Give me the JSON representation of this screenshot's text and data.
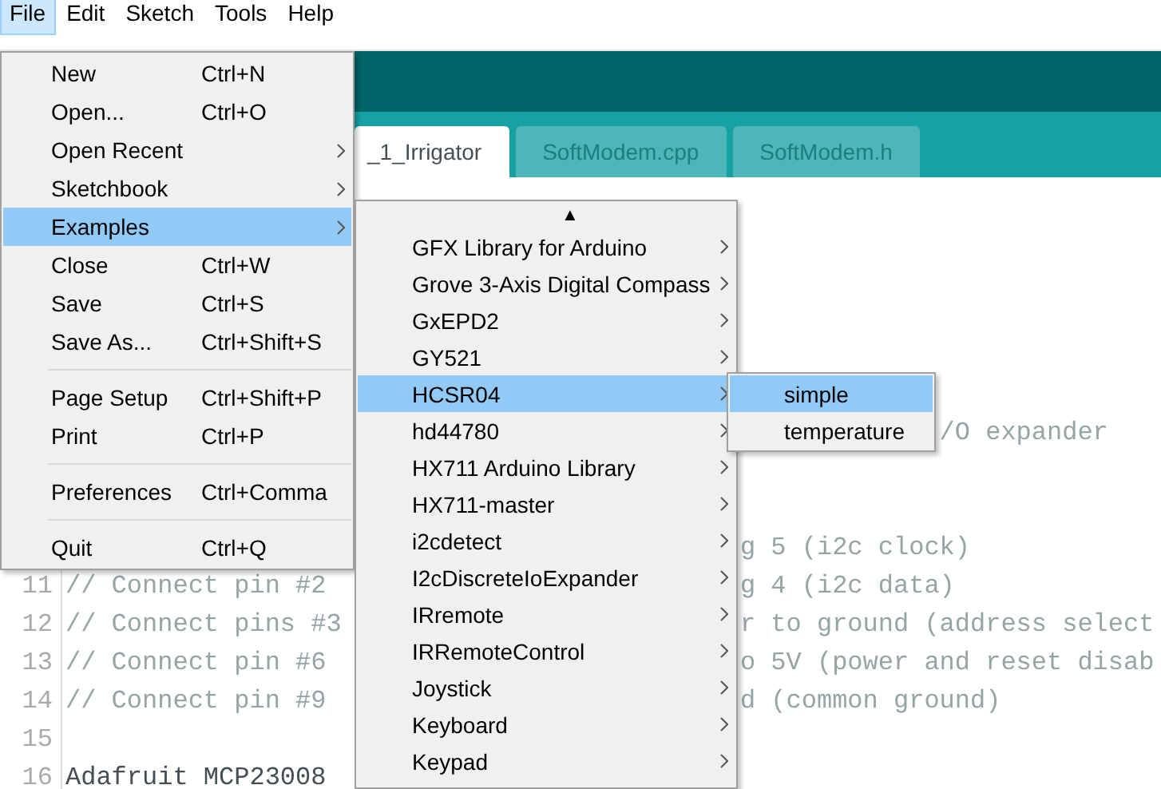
{
  "menubar": [
    {
      "label": "File",
      "selected": true
    },
    {
      "label": "Edit",
      "selected": false
    },
    {
      "label": "Sketch",
      "selected": false
    },
    {
      "label": "Tools",
      "selected": false
    },
    {
      "label": "Help",
      "selected": false
    }
  ],
  "tabs": [
    {
      "label": "_1_Irrigator",
      "selected": true
    },
    {
      "label": "SoftModem.cpp",
      "selected": false
    },
    {
      "label": "SoftModem.h",
      "selected": false
    }
  ],
  "editor": {
    "lines": [
      {
        "kind": "comment",
        "right": "/O expander"
      },
      {
        "kind": "comment"
      },
      {
        "kind": "comment"
      },
      {
        "kind": "comment",
        "right": "g 5 (i2c clock)"
      },
      {
        "kind": "comment",
        "number": "11",
        "left": "// Connect pin #2",
        "right": "g 4 (i2c data)"
      },
      {
        "kind": "comment",
        "number": "12",
        "left": "// Connect pins #3",
        "right": "r to ground (address select"
      },
      {
        "kind": "comment",
        "number": "13",
        "left": "// Connect pin #6",
        "right": "o 5V (power and reset disab"
      },
      {
        "kind": "comment",
        "number": "14",
        "left": "// Connect pin #9",
        "right": "d (common ground)"
      },
      {
        "kind": "code",
        "number": "15"
      },
      {
        "kind": "code",
        "number": "16",
        "left": "Adafruit MCP23008"
      }
    ]
  },
  "file_menu": {
    "items": [
      {
        "kind": "item",
        "label": "New",
        "shortcut": "Ctrl+N",
        "submenu": false,
        "selected": false
      },
      {
        "kind": "item",
        "label": "Open...",
        "shortcut": "Ctrl+O",
        "submenu": false,
        "selected": false
      },
      {
        "kind": "item",
        "label": "Open Recent",
        "submenu": true,
        "selected": false
      },
      {
        "kind": "item",
        "label": "Sketchbook",
        "submenu": true,
        "selected": false
      },
      {
        "kind": "item",
        "label": "Examples",
        "submenu": true,
        "selected": true
      },
      {
        "kind": "item",
        "label": "Close",
        "shortcut": "Ctrl+W",
        "submenu": false,
        "selected": false
      },
      {
        "kind": "item",
        "label": "Save",
        "shortcut": "Ctrl+S",
        "submenu": false,
        "selected": false
      },
      {
        "kind": "item",
        "label": "Save As...",
        "shortcut": "Ctrl+Shift+S",
        "submenu": false,
        "selected": false
      },
      {
        "kind": "separator"
      },
      {
        "kind": "item",
        "label": "Page Setup",
        "shortcut": "Ctrl+Shift+P",
        "submenu": false,
        "selected": false
      },
      {
        "kind": "item",
        "label": "Print",
        "shortcut": "Ctrl+P",
        "submenu": false,
        "selected": false
      },
      {
        "kind": "separator"
      },
      {
        "kind": "item",
        "label": "Preferences",
        "shortcut": "Ctrl+Comma",
        "submenu": false,
        "selected": false
      },
      {
        "kind": "separator"
      },
      {
        "kind": "item",
        "label": "Quit",
        "shortcut": "Ctrl+Q",
        "submenu": false,
        "selected": false
      }
    ]
  },
  "examples_menu": {
    "scroll_up": "▲",
    "items": [
      {
        "label": "GFX Library for Arduino",
        "submenu": true,
        "selected": false
      },
      {
        "label": "Grove 3-Axis Digital Compass",
        "submenu": true,
        "selected": false
      },
      {
        "label": "GxEPD2",
        "submenu": true,
        "selected": false
      },
      {
        "label": "GY521",
        "submenu": true,
        "selected": false
      },
      {
        "label": "HCSR04",
        "submenu": true,
        "selected": true
      },
      {
        "label": "hd44780",
        "submenu": true,
        "selected": false
      },
      {
        "label": "HX711 Arduino Library",
        "submenu": true,
        "selected": false
      },
      {
        "label": "HX711-master",
        "submenu": true,
        "selected": false
      },
      {
        "label": "i2cdetect",
        "submenu": true,
        "selected": false
      },
      {
        "label": "I2cDiscreteIoExpander",
        "submenu": true,
        "selected": false
      },
      {
        "label": "IRremote",
        "submenu": true,
        "selected": false
      },
      {
        "label": "IRRemoteControl",
        "submenu": true,
        "selected": false
      },
      {
        "label": "Joystick",
        "submenu": true,
        "selected": false
      },
      {
        "label": "Keyboard",
        "submenu": true,
        "selected": false
      },
      {
        "label": "Keypad",
        "submenu": true,
        "selected": false
      }
    ]
  },
  "hcsr04_menu": {
    "items": [
      {
        "label": "simple",
        "submenu": false,
        "selected": true
      },
      {
        "label": "temperature",
        "submenu": false,
        "selected": false
      }
    ]
  }
}
